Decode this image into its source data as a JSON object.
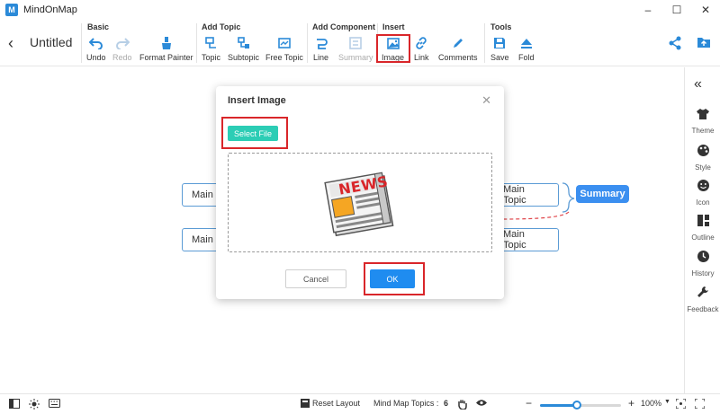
{
  "app": {
    "name": "MindOnMap"
  },
  "window": {
    "minimize": "–",
    "maximize": "☐",
    "close": "✕"
  },
  "document": {
    "title": "Untitled"
  },
  "toolbar": {
    "groups": {
      "basic": "Basic",
      "add_topic": "Add Topic",
      "add_component": "Add Component",
      "insert": "Insert",
      "tools": "Tools"
    },
    "items": {
      "undo": "Undo",
      "redo": "Redo",
      "format_painter": "Format Painter",
      "topic": "Topic",
      "subtopic": "Subtopic",
      "free_topic": "Free Topic",
      "line": "Line",
      "summary": "Summary",
      "image": "Image",
      "link": "Link",
      "comments": "Comments",
      "save": "Save",
      "fold": "Fold"
    }
  },
  "canvas": {
    "nodes": [
      "Main",
      "Main",
      "Main Topic",
      "Main Topic"
    ],
    "summary": "Summary"
  },
  "right_panel": {
    "items": [
      "Theme",
      "Style",
      "Icon",
      "Outline",
      "History",
      "Feedback"
    ]
  },
  "statusbar": {
    "reset_layout": "Reset Layout",
    "topics_label": "Mind Map Topics :",
    "topics_count": "6",
    "zoom_minus": "−",
    "zoom_plus": "+",
    "zoom_value": "100%",
    "zoom_fraction": 0.45
  },
  "dialog": {
    "title": "Insert Image",
    "close": "✕",
    "select_file": "Select File",
    "image_text": "NEWS",
    "cancel": "Cancel",
    "ok": "OK"
  },
  "colors": {
    "accent": "#1f8cf0",
    "select_button": "#2ccdb5",
    "highlight": "#d9262a",
    "node_border": "#5b9bd5"
  }
}
